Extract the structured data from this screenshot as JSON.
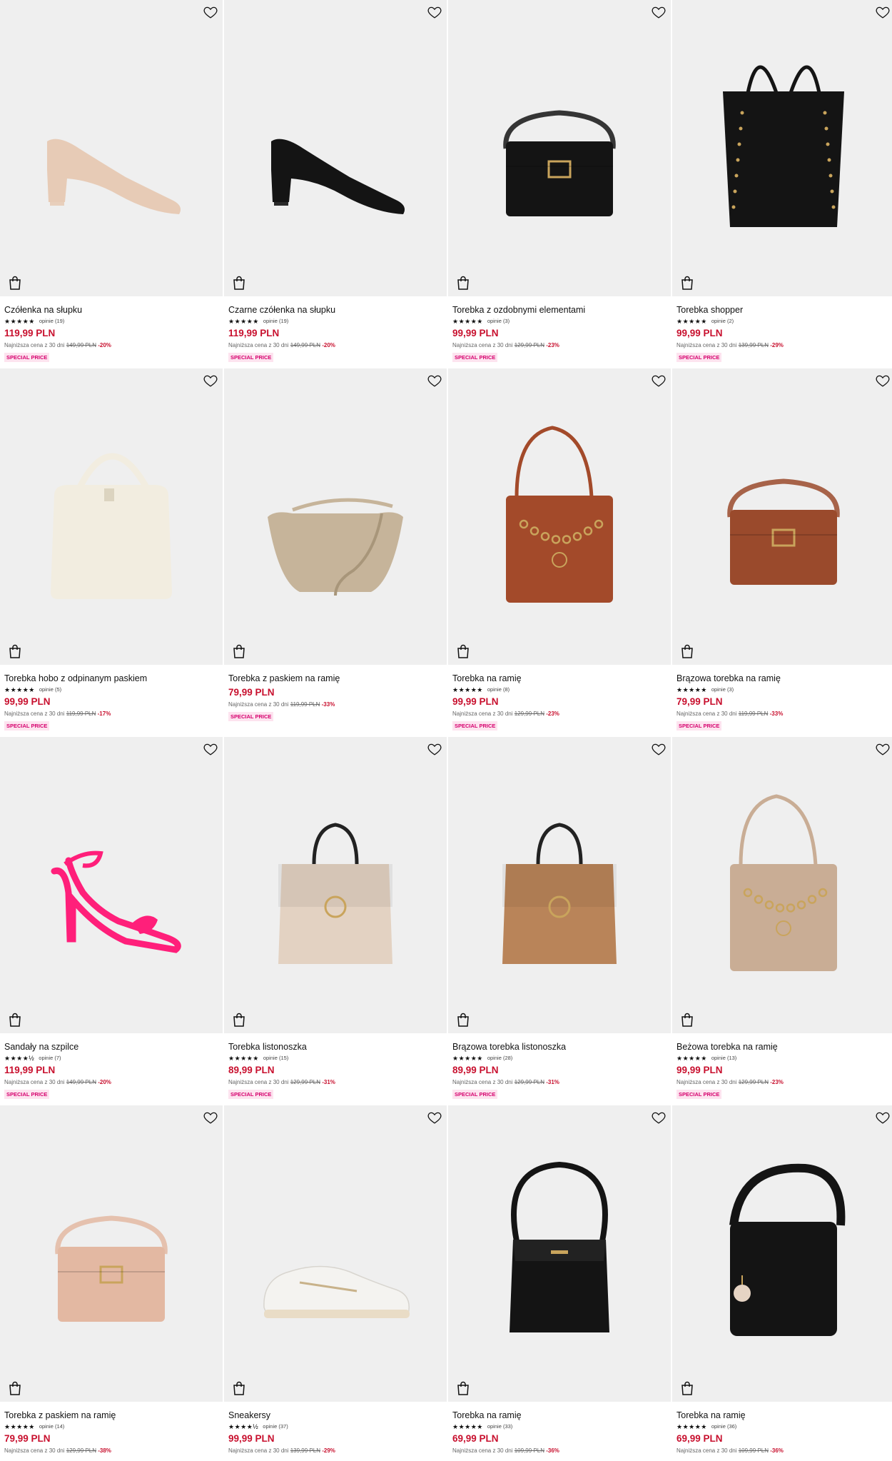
{
  "colors": {
    "price": "#c8102e",
    "badge_text": "#d6006e",
    "badge_bg": "#fde3ef",
    "image_bg": "#efefef"
  },
  "products": [
    {
      "title": "Czółenka na słupku",
      "stars": "★★★★★",
      "opinions": "opinie (19)",
      "price": "119,99 PLN",
      "lowest_label": "Najniższa cena z 30 dni",
      "old_price": "149,99 PLN",
      "discount": "-20%",
      "badge": "SPECIAL PRICE",
      "shape": "pump",
      "color": "#e7cbb6",
      "rating": 5
    },
    {
      "title": "Czarne czółenka na słupku",
      "stars": "★★★★★",
      "opinions": "opinie (19)",
      "price": "119,99 PLN",
      "lowest_label": "Najniższa cena z 30 dni",
      "old_price": "149,99 PLN",
      "discount": "-20%",
      "badge": "SPECIAL PRICE",
      "shape": "pump",
      "color": "#141414",
      "rating": 5
    },
    {
      "title": "Torebka z ozdobnymi elementami",
      "stars": "★★★★★",
      "opinions": "opinie (3)",
      "price": "99,99 PLN",
      "lowest_label": "Najniższa cena z 30 dni",
      "old_price": "129,99 PLN",
      "discount": "-23%",
      "badge": "SPECIAL PRICE",
      "shape": "crossbody",
      "color": "#141414",
      "rating": 5
    },
    {
      "title": "Torebka shopper",
      "stars": "★★★★★",
      "opinions": "opinie (2)",
      "price": "99,99 PLN",
      "lowest_label": "Najniższa cena z 30 dni",
      "old_price": "139,99 PLN",
      "discount": "-29%",
      "badge": "SPECIAL PRICE",
      "shape": "tote",
      "color": "#141414",
      "rating": 5
    },
    {
      "title": "Torebka hobo z odpinanym paskiem",
      "stars": "★★★★★",
      "opinions": "opinie (5)",
      "price": "99,99 PLN",
      "lowest_label": "Najniższa cena z 30 dni",
      "old_price": "119,99 PLN",
      "discount": "-17%",
      "badge": "SPECIAL PRICE",
      "shape": "hobo",
      "color": "#f2ede0",
      "rating": 5
    },
    {
      "title": "Torebka z paskiem na ramię",
      "stars": "",
      "opinions": "",
      "price": "79,99 PLN",
      "lowest_label": "Najniższa cena z 30 dni",
      "old_price": "119,99 PLN",
      "discount": "-33%",
      "badge": "SPECIAL PRICE",
      "shape": "bucket",
      "color": "#c6b49a",
      "rating": 0
    },
    {
      "title": "Torebka na ramię",
      "stars": "★★★★★",
      "opinions": "opinie (8)",
      "price": "99,99 PLN",
      "lowest_label": "Najniższa cena z 30 dni",
      "old_price": "129,99 PLN",
      "discount": "-23%",
      "badge": "SPECIAL PRICE",
      "shape": "chainbag",
      "color": "#a34a2a",
      "rating": 5
    },
    {
      "title": "Brązowa torebka na ramię",
      "stars": "★★★★★",
      "opinions": "opinie (3)",
      "price": "79,99 PLN",
      "lowest_label": "Najniższa cena z 30 dni",
      "old_price": "119,99 PLN",
      "discount": "-33%",
      "badge": "SPECIAL PRICE",
      "shape": "crossbody",
      "color": "#9a4a2c",
      "rating": 5
    },
    {
      "title": "Sandały na szpilce",
      "stars": "★★★★½",
      "opinions": "opinie (7)",
      "price": "119,99 PLN",
      "lowest_label": "Najniższa cena z 30 dni",
      "old_price": "149,99 PLN",
      "discount": "-20%",
      "badge": "SPECIAL PRICE",
      "shape": "sandal",
      "color": "#ff1f7a",
      "rating": 4.5
    },
    {
      "title": "Torebka listonoszka",
      "stars": "★★★★★",
      "opinions": "opinie (15)",
      "price": "89,99 PLN",
      "lowest_label": "Najniższa cena z 30 dni",
      "old_price": "129,99 PLN",
      "discount": "-31%",
      "badge": "SPECIAL PRICE",
      "shape": "satchel",
      "color": "#e3d2c2",
      "rating": 5
    },
    {
      "title": "Brązowa torebka listonoszka",
      "stars": "★★★★★",
      "opinions": "opinie (28)",
      "price": "89,99 PLN",
      "lowest_label": "Najniższa cena z 30 dni",
      "old_price": "129,99 PLN",
      "discount": "-31%",
      "badge": "SPECIAL PRICE",
      "shape": "satchel",
      "color": "#b98459",
      "rating": 5
    },
    {
      "title": "Beżowa torebka na ramię",
      "stars": "★★★★★",
      "opinions": "opinie (13)",
      "price": "99,99 PLN",
      "lowest_label": "Najniższa cena z 30 dni",
      "old_price": "129,99 PLN",
      "discount": "-23%",
      "badge": "SPECIAL PRICE",
      "shape": "chainbag",
      "color": "#c9ad95",
      "rating": 5
    },
    {
      "title": "Torebka z paskiem na ramię",
      "stars": "★★★★★",
      "opinions": "opinie (14)",
      "price": "79,99 PLN",
      "lowest_label": "Najniższa cena z 30 dni",
      "old_price": "129,99 PLN",
      "discount": "-38%",
      "badge": "",
      "shape": "crossbody",
      "color": "#e3b8a2",
      "rating": 5
    },
    {
      "title": "Sneakersy",
      "stars": "★★★★½",
      "opinions": "opinie (37)",
      "price": "99,99 PLN",
      "lowest_label": "Najniższa cena z 30 dni",
      "old_price": "139,99 PLN",
      "discount": "-29%",
      "badge": "",
      "shape": "sneaker",
      "color": "#f4f3f0",
      "rating": 4.5
    },
    {
      "title": "Torebka na ramię",
      "stars": "★★★★★",
      "opinions": "opinie (33)",
      "price": "69,99 PLN",
      "lowest_label": "Najniższa cena z 30 dni",
      "old_price": "109,99 PLN",
      "discount": "-36%",
      "badge": "",
      "shape": "messenger",
      "color": "#141414",
      "rating": 5
    },
    {
      "title": "Torebka na ramię",
      "stars": "★★★★★",
      "opinions": "opinie (36)",
      "price": "69,99 PLN",
      "lowest_label": "Najniższa cena z 30 dni",
      "old_price": "109,99 PLN",
      "discount": "-36%",
      "badge": "",
      "shape": "messenger2",
      "color": "#141414",
      "rating": 5
    }
  ]
}
